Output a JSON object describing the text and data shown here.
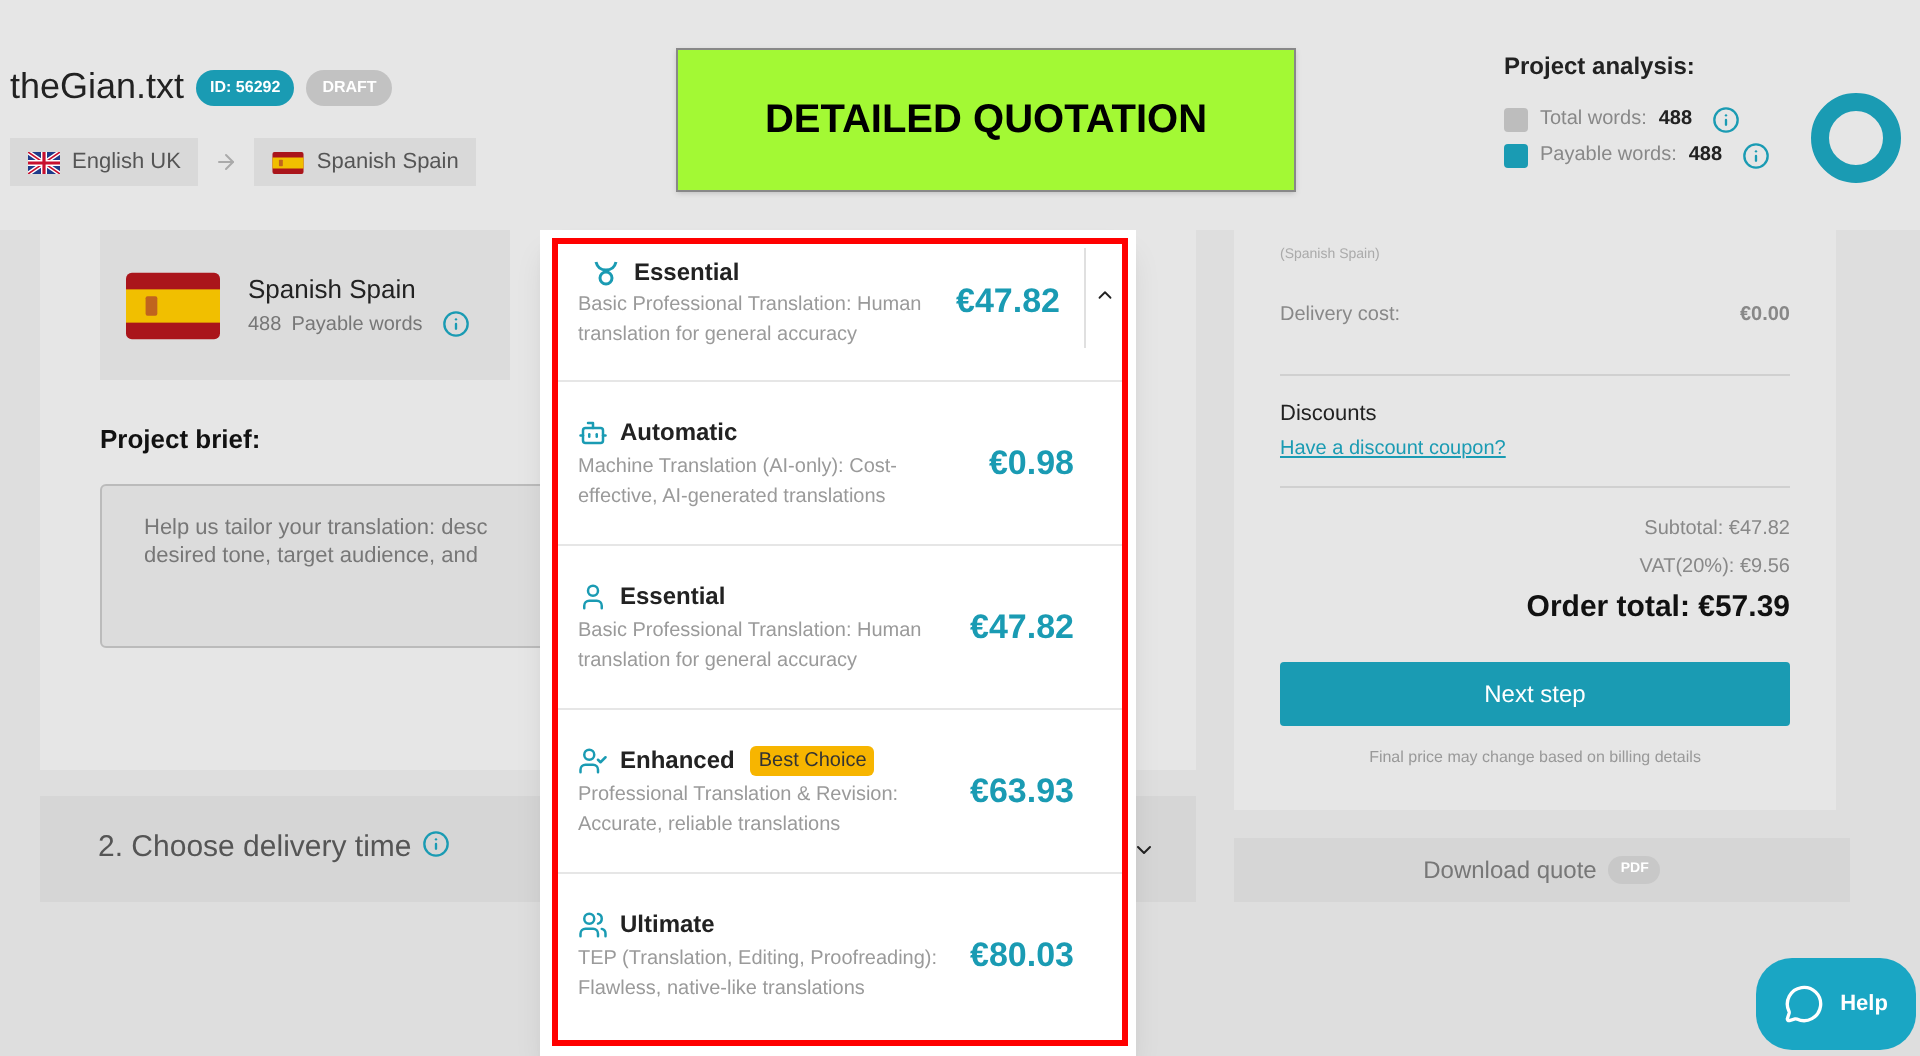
{
  "header": {
    "file_name": "theGian.txt",
    "id_badge": "ID: 56292",
    "status_badge": "DRAFT",
    "source_language": "English UK",
    "target_language": "Spanish Spain"
  },
  "banner": "DETAILED QUOTATION",
  "analysis": {
    "title": "Project analysis:",
    "legend": [
      {
        "label": "Total words:",
        "value": "488",
        "color": "#bdbdbd"
      },
      {
        "label": "Payable words:",
        "value": "488",
        "color": "#1a9bb3"
      }
    ]
  },
  "language_card": {
    "language": "Spanish Spain",
    "count": "488",
    "unit": "Payable words"
  },
  "brief": {
    "title": "Project brief:",
    "placeholder_lines": [
      "Help us tailor your translation: desc",
      "desired tone, target audience, and"
    ]
  },
  "delivery": {
    "title": "2. Choose delivery time"
  },
  "summary": {
    "language_note": "(Spanish Spain)",
    "delivery_label": "Delivery cost:",
    "delivery_value": "€0.00",
    "discounts_title": "Discounts",
    "coupon_link": "Have a discount coupon?",
    "subtotal": "Subtotal: €47.82",
    "vat": "VAT(20%): €9.56",
    "total": "Order total: €57.39",
    "next_button": "Next step",
    "note": "Final price may change based on billing details"
  },
  "download": {
    "label": "Download quote",
    "badge": "PDF"
  },
  "dropdown": {
    "current": {
      "name": "Essential",
      "description": "Basic Professional Translation: Human translation for general accuracy",
      "price": "€47.82"
    },
    "options": [
      {
        "kind": "machine",
        "name": "Automatic",
        "description": "Machine Translation (AI-only): Cost-effective, AI-generated translations",
        "price": "€0.98"
      },
      {
        "kind": "human",
        "name": "Essential",
        "description": "Basic Professional Translation: Human translation for general accuracy",
        "price": "€47.82"
      },
      {
        "kind": "revision",
        "name": "Enhanced",
        "badge": "Best Choice",
        "description": "Professional Translation & Revision: Accurate, reliable translations",
        "price": "€63.93"
      },
      {
        "kind": "team",
        "name": "Ultimate",
        "description": "TEP (Translation, Editing, Proofreading): Flawless, native-like translations",
        "price": "€80.03"
      }
    ]
  },
  "help_button": "Help"
}
